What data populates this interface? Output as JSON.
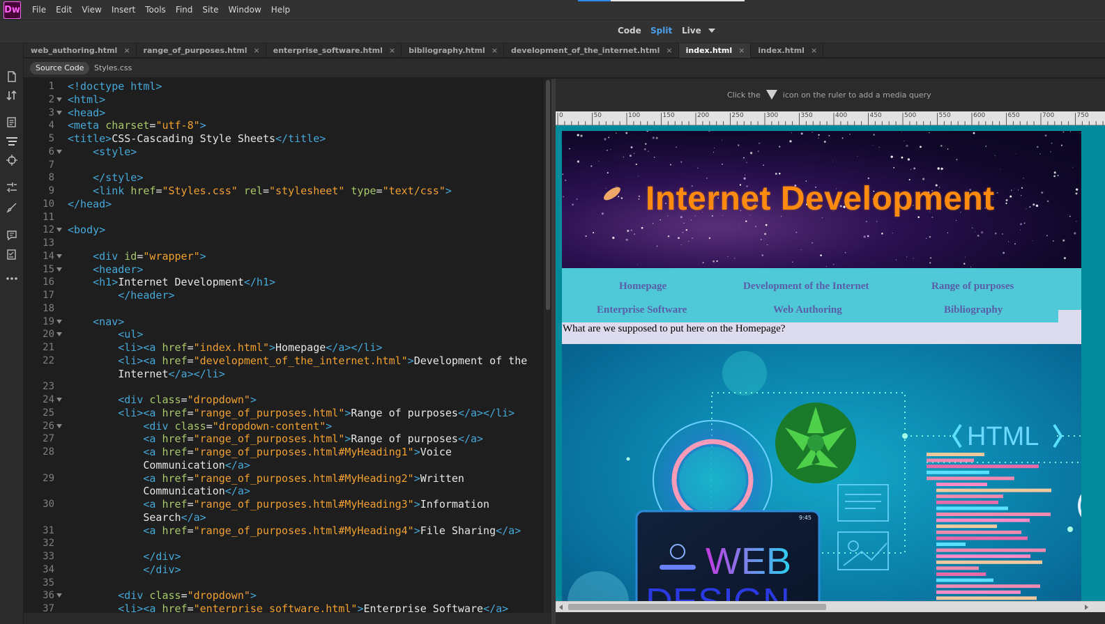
{
  "app": {
    "logo": "Dw"
  },
  "menus": [
    "File",
    "Edit",
    "View",
    "Insert",
    "Tools",
    "Find",
    "Site",
    "Window",
    "Help"
  ],
  "view_switcher": {
    "code": "Code",
    "split": "Split",
    "live": "Live",
    "active_color": "#4ba0ee"
  },
  "tabs": [
    {
      "label": "web_authoring.html",
      "active": false
    },
    {
      "label": "range_of_purposes.html",
      "active": false
    },
    {
      "label": "enterprise_software.html",
      "active": false
    },
    {
      "label": "bibliography.html",
      "active": false
    },
    {
      "label": "development_of_the_internet.html",
      "active": false
    },
    {
      "label": "index.html",
      "active": true
    },
    {
      "label": "index.html",
      "active": false
    }
  ],
  "tab_close_glyph": "×",
  "related_files": {
    "source": "Source Code",
    "styles": "Styles.css"
  },
  "tools": [
    "new-document-icon",
    "file-transfer-icon",
    "files-panel-icon",
    "dom-panel-icon",
    "target-icon",
    "css-transition-icon",
    "brush-icon",
    "comment-icon",
    "checklist-icon",
    "more-icon"
  ],
  "code": {
    "line_numbers": [
      "1",
      "2",
      "3",
      "4",
      "5",
      "6",
      "7",
      "8",
      "9",
      "10",
      "11",
      "12",
      "13",
      "14",
      "15",
      "16",
      "17",
      "18",
      "19",
      "20",
      "21",
      "22",
      "",
      "23",
      "24",
      "25",
      "26",
      "27",
      "28",
      "",
      "29",
      "",
      "30",
      "",
      "31",
      "32",
      "33",
      "34",
      "35",
      "36",
      "37"
    ],
    "lines": [
      [
        [
          "t",
          "<!doctype html>"
        ]
      ],
      [
        [
          "t",
          "<html>"
        ]
      ],
      [
        [
          "t",
          "<head>"
        ]
      ],
      [
        [
          "t",
          "<meta "
        ],
        [
          "a",
          "charset"
        ],
        [
          "x",
          "="
        ],
        [
          "v",
          "\"utf-8\""
        ],
        [
          "t",
          ">"
        ]
      ],
      [
        [
          "t",
          "<title>"
        ],
        [
          "x",
          "CSS-Cascading Style Sheets"
        ],
        [
          "t",
          "</title>"
        ]
      ],
      [
        [
          "x",
          "    "
        ],
        [
          "t",
          "<style>"
        ]
      ],
      [
        [
          "x",
          ""
        ]
      ],
      [
        [
          "x",
          "    "
        ],
        [
          "t",
          "</style>"
        ]
      ],
      [
        [
          "x",
          "    "
        ],
        [
          "t",
          "<link "
        ],
        [
          "a",
          "href"
        ],
        [
          "x",
          "="
        ],
        [
          "v",
          "\"Styles.css\""
        ],
        [
          "x",
          " "
        ],
        [
          "a",
          "rel"
        ],
        [
          "x",
          "="
        ],
        [
          "v",
          "\"stylesheet\""
        ],
        [
          "x",
          " "
        ],
        [
          "a",
          "type"
        ],
        [
          "x",
          "="
        ],
        [
          "v",
          "\"text/css\""
        ],
        [
          "t",
          ">"
        ]
      ],
      [
        [
          "t",
          "</head>"
        ]
      ],
      [
        [
          "x",
          ""
        ]
      ],
      [
        [
          "t",
          "<body>"
        ]
      ],
      [
        [
          "x",
          ""
        ]
      ],
      [
        [
          "x",
          "    "
        ],
        [
          "t",
          "<div "
        ],
        [
          "a",
          "id"
        ],
        [
          "x",
          "="
        ],
        [
          "v",
          "\"wrapper\""
        ],
        [
          "t",
          ">"
        ]
      ],
      [
        [
          "x",
          "    "
        ],
        [
          "t",
          "<header>"
        ]
      ],
      [
        [
          "x",
          "    "
        ],
        [
          "t",
          "<h1>"
        ],
        [
          "x",
          "Internet Development"
        ],
        [
          "t",
          "</h1>"
        ]
      ],
      [
        [
          "x",
          "        "
        ],
        [
          "t",
          "</header>"
        ]
      ],
      [
        [
          "x",
          ""
        ]
      ],
      [
        [
          "x",
          "    "
        ],
        [
          "t",
          "<nav>"
        ]
      ],
      [
        [
          "x",
          "        "
        ],
        [
          "t",
          "<ul>"
        ]
      ],
      [
        [
          "x",
          "        "
        ],
        [
          "t",
          "<li><a "
        ],
        [
          "a",
          "href"
        ],
        [
          "x",
          "="
        ],
        [
          "v",
          "\"index.html\""
        ],
        [
          "t",
          ">"
        ],
        [
          "x",
          "Homepage"
        ],
        [
          "t",
          "</a></li>"
        ]
      ],
      [
        [
          "x",
          "        "
        ],
        [
          "t",
          "<li><a "
        ],
        [
          "a",
          "href"
        ],
        [
          "x",
          "="
        ],
        [
          "v",
          "\"development_of_the_internet.html\""
        ],
        [
          "t",
          ">"
        ],
        [
          "x",
          "Development of the"
        ]
      ],
      [
        [
          "x",
          "        Internet"
        ],
        [
          "t",
          "</a></li>"
        ]
      ],
      [
        [
          "x",
          ""
        ]
      ],
      [
        [
          "x",
          "        "
        ],
        [
          "t",
          "<div "
        ],
        [
          "a",
          "class"
        ],
        [
          "x",
          "="
        ],
        [
          "v",
          "\"dropdown\""
        ],
        [
          "t",
          ">"
        ]
      ],
      [
        [
          "x",
          "        "
        ],
        [
          "t",
          "<li><a "
        ],
        [
          "a",
          "href"
        ],
        [
          "x",
          "="
        ],
        [
          "v",
          "\"range_of_purposes.html\""
        ],
        [
          "t",
          ">"
        ],
        [
          "x",
          "Range of purposes"
        ],
        [
          "t",
          "</a></li>"
        ]
      ],
      [
        [
          "x",
          "            "
        ],
        [
          "t",
          "<div "
        ],
        [
          "a",
          "class"
        ],
        [
          "x",
          "="
        ],
        [
          "v",
          "\"dropdown-content\""
        ],
        [
          "t",
          ">"
        ]
      ],
      [
        [
          "x",
          "            "
        ],
        [
          "t",
          "<a "
        ],
        [
          "a",
          "href"
        ],
        [
          "x",
          "="
        ],
        [
          "v",
          "\"range_of_purposes.html\""
        ],
        [
          "t",
          ">"
        ],
        [
          "x",
          "Range of purposes"
        ],
        [
          "t",
          "</a>"
        ]
      ],
      [
        [
          "x",
          "            "
        ],
        [
          "t",
          "<a "
        ],
        [
          "a",
          "href"
        ],
        [
          "x",
          "="
        ],
        [
          "v",
          "\"range_of_purposes.html#MyHeading1\""
        ],
        [
          "t",
          ">"
        ],
        [
          "x",
          "Voice"
        ]
      ],
      [
        [
          "x",
          "            Communication"
        ],
        [
          "t",
          "</a>"
        ]
      ],
      [
        [
          "x",
          "            "
        ],
        [
          "t",
          "<a "
        ],
        [
          "a",
          "href"
        ],
        [
          "x",
          "="
        ],
        [
          "v",
          "\"range_of_purposes.html#MyHeading2\""
        ],
        [
          "t",
          ">"
        ],
        [
          "x",
          "Written"
        ]
      ],
      [
        [
          "x",
          "            Communication"
        ],
        [
          "t",
          "</a>"
        ]
      ],
      [
        [
          "x",
          "            "
        ],
        [
          "t",
          "<a "
        ],
        [
          "a",
          "href"
        ],
        [
          "x",
          "="
        ],
        [
          "v",
          "\"range_of_purposes.html#MyHeading3\""
        ],
        [
          "t",
          ">"
        ],
        [
          "x",
          "Information"
        ]
      ],
      [
        [
          "x",
          "            Search"
        ],
        [
          "t",
          "</a>"
        ]
      ],
      [
        [
          "x",
          "            "
        ],
        [
          "t",
          "<a "
        ],
        [
          "a",
          "href"
        ],
        [
          "x",
          "="
        ],
        [
          "v",
          "\"range_of_purposes.html#MyHeading4\""
        ],
        [
          "t",
          ">"
        ],
        [
          "x",
          "File Sharing"
        ],
        [
          "t",
          "</a>"
        ]
      ],
      [
        [
          "x",
          ""
        ]
      ],
      [
        [
          "x",
          "            "
        ],
        [
          "t",
          "</div>"
        ]
      ],
      [
        [
          "x",
          "            "
        ],
        [
          "t",
          "</div>"
        ]
      ],
      [
        [
          "x",
          ""
        ]
      ],
      [
        [
          "x",
          "        "
        ],
        [
          "t",
          "<div "
        ],
        [
          "a",
          "class"
        ],
        [
          "x",
          "="
        ],
        [
          "v",
          "\"dropdown\""
        ],
        [
          "t",
          ">"
        ]
      ],
      [
        [
          "x",
          "        "
        ],
        [
          "t",
          "<li><a "
        ],
        [
          "a",
          "href"
        ],
        [
          "x",
          "="
        ],
        [
          "v",
          "\"enterprise_software.html\""
        ],
        [
          "t",
          ">"
        ],
        [
          "x",
          "Enterprise Software"
        ],
        [
          "t",
          "</a>"
        ]
      ]
    ],
    "fold_lines": [
      2,
      3,
      6,
      12,
      14,
      15,
      19,
      20,
      24,
      26,
      36
    ],
    "colors": {
      "tag": "#46a8d8",
      "attr": "#a8c86a",
      "value": "#f0a030",
      "text": "#e6e6e6"
    }
  },
  "live_view": {
    "media_query_hint_before": "Click the",
    "media_query_hint_after": "icon on the ruler to add a media query",
    "ruler_ticks": [
      "0",
      "50",
      "100",
      "150",
      "200",
      "250",
      "300",
      "350",
      "400",
      "450",
      "500",
      "550",
      "600",
      "650",
      "700",
      "750"
    ],
    "page": {
      "h1": "Internet Development",
      "nav_links": [
        "Homepage",
        "Development of the Internet",
        "Range of purposes",
        "Enterprise Software",
        "Web Authoring",
        "Bibliography"
      ],
      "content_text": "What are we supposed to put here on the Homepage?",
      "hero_text_html": "HTML",
      "hero_text_web": "WEB",
      "hero_text_design": "DESIGN",
      "phone_time": "9:45"
    },
    "colors": {
      "h1": "#ff8a0e",
      "nav_bg": "#4fc8d8",
      "nav_link": "#5a5ea8",
      "content_bg": "#dcdcee"
    }
  }
}
